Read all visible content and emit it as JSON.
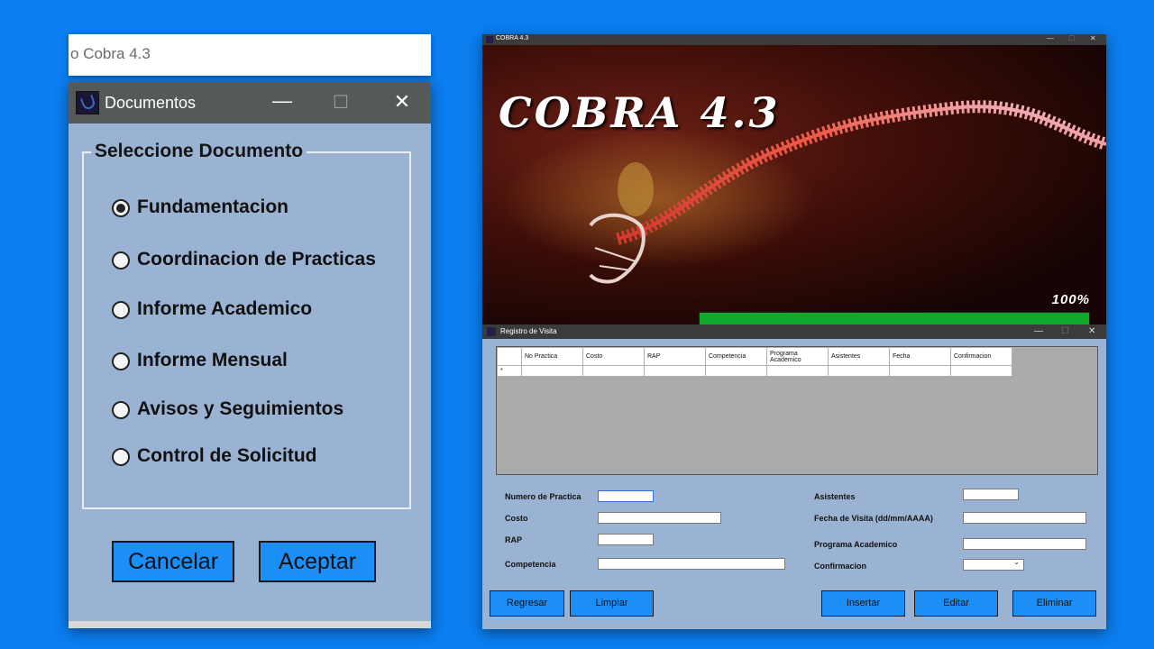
{
  "background_window": {
    "title_fragment": "o Cobra 4.3"
  },
  "documentos": {
    "title": "Documentos",
    "controls": {
      "minimize": "—",
      "maximize": "☐",
      "close": "✕"
    },
    "group_label": "Seleccione Documento",
    "options": [
      {
        "label": "Fundamentacion",
        "checked": true
      },
      {
        "label": "Coordinacion de Practicas",
        "checked": false
      },
      {
        "label": "Informe Academico",
        "checked": false
      },
      {
        "label": "Informe Mensual",
        "checked": false
      },
      {
        "label": "Avisos y Seguimientos",
        "checked": false
      },
      {
        "label": "Control de Solicitud",
        "checked": false
      }
    ],
    "buttons": {
      "cancel": "Cancelar",
      "accept": "Aceptar"
    }
  },
  "cobra": {
    "window_title": "COBRA 4.3",
    "controls": {
      "minimize": "—",
      "maximize": "☐",
      "close": "✕"
    },
    "splash_title": "COBRA 4.3",
    "progress_label": "100%",
    "progress": 1.0,
    "colors": {
      "progress_fill": "#0faa2c",
      "button": "#1b8ff7",
      "form_bg": "#9ab3d3"
    }
  },
  "registro": {
    "title": "Registro de Visita",
    "controls": {
      "minimize": "—",
      "maximize": "☐",
      "close": "✕"
    },
    "grid": {
      "columns": [
        "No Practica",
        "Costo",
        "RAP",
        "Competencia",
        "Programa Academico",
        "Asistentes",
        "Fecha",
        "Confirmacion"
      ],
      "new_row_marker": "*"
    },
    "fields": {
      "numero_practica": {
        "label": "Numero de Practica",
        "value": ""
      },
      "costo": {
        "label": "Costo",
        "value": ""
      },
      "rap": {
        "label": "RAP",
        "value": ""
      },
      "competencia": {
        "label": "Competencia",
        "value": ""
      },
      "asistentes": {
        "label": "Asistentes",
        "value": ""
      },
      "fecha_visita": {
        "label": "Fecha de Visita (dd/mm/AAAA)",
        "value": ""
      },
      "programa_academico": {
        "label": "Programa Academico",
        "value": ""
      },
      "confirmacion": {
        "label": "Confirmacion",
        "value": ""
      }
    },
    "buttons": {
      "regresar": "Regresar",
      "limpiar": "Limpiar",
      "insertar": "Insertar",
      "editar": "Editar",
      "eliminar": "Eliminar"
    }
  }
}
